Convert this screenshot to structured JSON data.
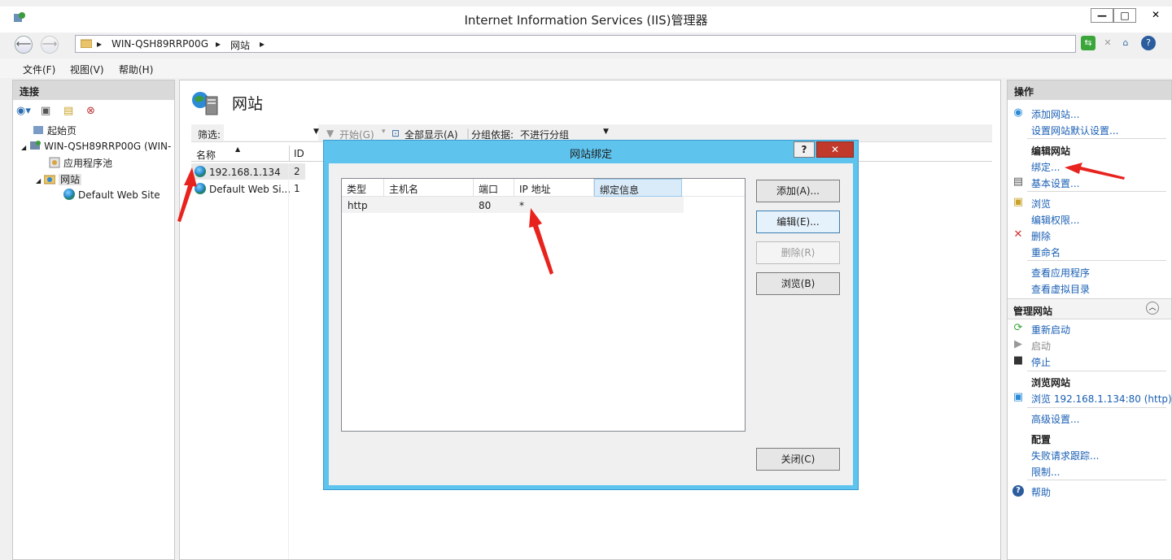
{
  "window": {
    "title": "Internet Information Services (IIS)管理器",
    "controls": {
      "minimize": "—",
      "maximize": "□",
      "close": "✕"
    }
  },
  "address": {
    "server": "WIN-QSH89RRP00G",
    "sep1": "▸",
    "section": "网站",
    "sep2": "▸"
  },
  "menu": {
    "file": "文件(F)",
    "view": "视图(V)",
    "help": "帮助(H)"
  },
  "left": {
    "header": "连接",
    "tree": {
      "start": "起始页",
      "server": "WIN-QSH89RRP00G (WIN-",
      "apppools": "应用程序池",
      "sites": "网站",
      "default_site": "Default Web Site"
    }
  },
  "center": {
    "title": "网站",
    "filter": {
      "label": "筛选:",
      "start": "开始(G)",
      "showall": "全部显示(A)",
      "group_label": "分组依据:",
      "group_value": "不进行分组"
    },
    "columns": {
      "name": "名称",
      "id": "ID"
    },
    "rows": [
      {
        "name": "192.168.1.134",
        "id": "2"
      },
      {
        "name": "Default Web Si...",
        "id": "1"
      }
    ]
  },
  "dialog": {
    "title": "网站绑定",
    "help": "?",
    "close": "✕",
    "columns": {
      "type": "类型",
      "host": "主机名",
      "port": "端口",
      "ip": "IP 地址",
      "info": "绑定信息"
    },
    "binding": {
      "type": "http",
      "host": "",
      "port": "80",
      "ip": "*",
      "info": ""
    },
    "buttons": {
      "add": "添加(A)...",
      "edit": "编辑(E)...",
      "remove": "删除(R)",
      "browse": "浏览(B)",
      "close": "关闭(C)"
    }
  },
  "actions": {
    "header": "操作",
    "add_site": "添加网站...",
    "default_settings": "设置网站默认设置...",
    "edit_site_group": "编辑网站",
    "bindings": "绑定...",
    "basic_settings": "基本设置...",
    "browse": "浏览",
    "edit_permissions": "编辑权限...",
    "delete": "删除",
    "rename": "重命名",
    "view_apps": "查看应用程序",
    "view_vdirs": "查看虚拟目录",
    "manage_group": "管理网站",
    "restart": "重新启动",
    "start": "启动",
    "stop": "停止",
    "browse_group": "浏览网站",
    "browse_url": "浏览 192.168.1.134:80 (http)",
    "advanced": "高级设置...",
    "config_group": "配置",
    "failed_tracing": "失败请求跟踪...",
    "limits": "限制...",
    "help": "帮助"
  },
  "colors": {
    "accent": "#1a5fb4",
    "dialog_frame": "#5ec4ee",
    "close_red": "#c0392b",
    "annotation": "#e8231e"
  }
}
